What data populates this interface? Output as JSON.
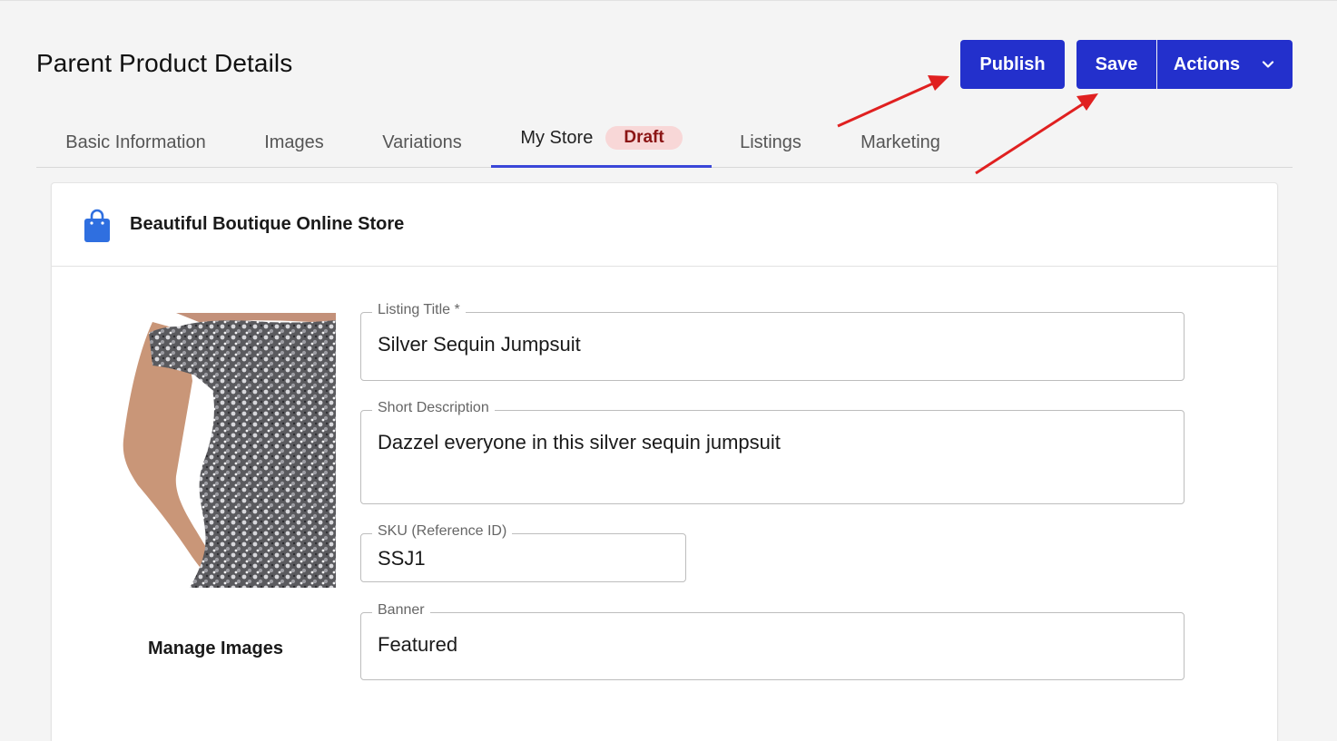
{
  "header": {
    "title": "Parent Product Details",
    "publish_label": "Publish",
    "save_label": "Save",
    "actions_label": "Actions"
  },
  "tabs": [
    {
      "label": "Basic Information"
    },
    {
      "label": "Images"
    },
    {
      "label": "Variations"
    },
    {
      "label": "My Store",
      "badge": "Draft",
      "active": true
    },
    {
      "label": "Listings"
    },
    {
      "label": "Marketing"
    }
  ],
  "store": {
    "name": "Beautiful Boutique Online Store",
    "icon": "shopping-bag-icon"
  },
  "product": {
    "image_alt": "silver-sequin-jumpsuit-photo",
    "manage_images_label": "Manage Images"
  },
  "form": {
    "listing_title": {
      "label": "Listing Title *",
      "value": "Silver Sequin Jumpsuit"
    },
    "short_description": {
      "label": "Short Description",
      "value": "Dazzel everyone in this silver sequin jumpsuit"
    },
    "sku": {
      "label": "SKU (Reference ID)",
      "value": "SSJ1"
    },
    "banner": {
      "label": "Banner",
      "value": "Featured"
    }
  },
  "colors": {
    "primary_button": "#2330cc",
    "active_tab_underline": "#3a47d8",
    "draft_badge_bg": "#f8d7d7",
    "draft_badge_text": "#8b1414",
    "store_icon": "#2f6fe0",
    "annotation_arrow": "#e02020"
  }
}
